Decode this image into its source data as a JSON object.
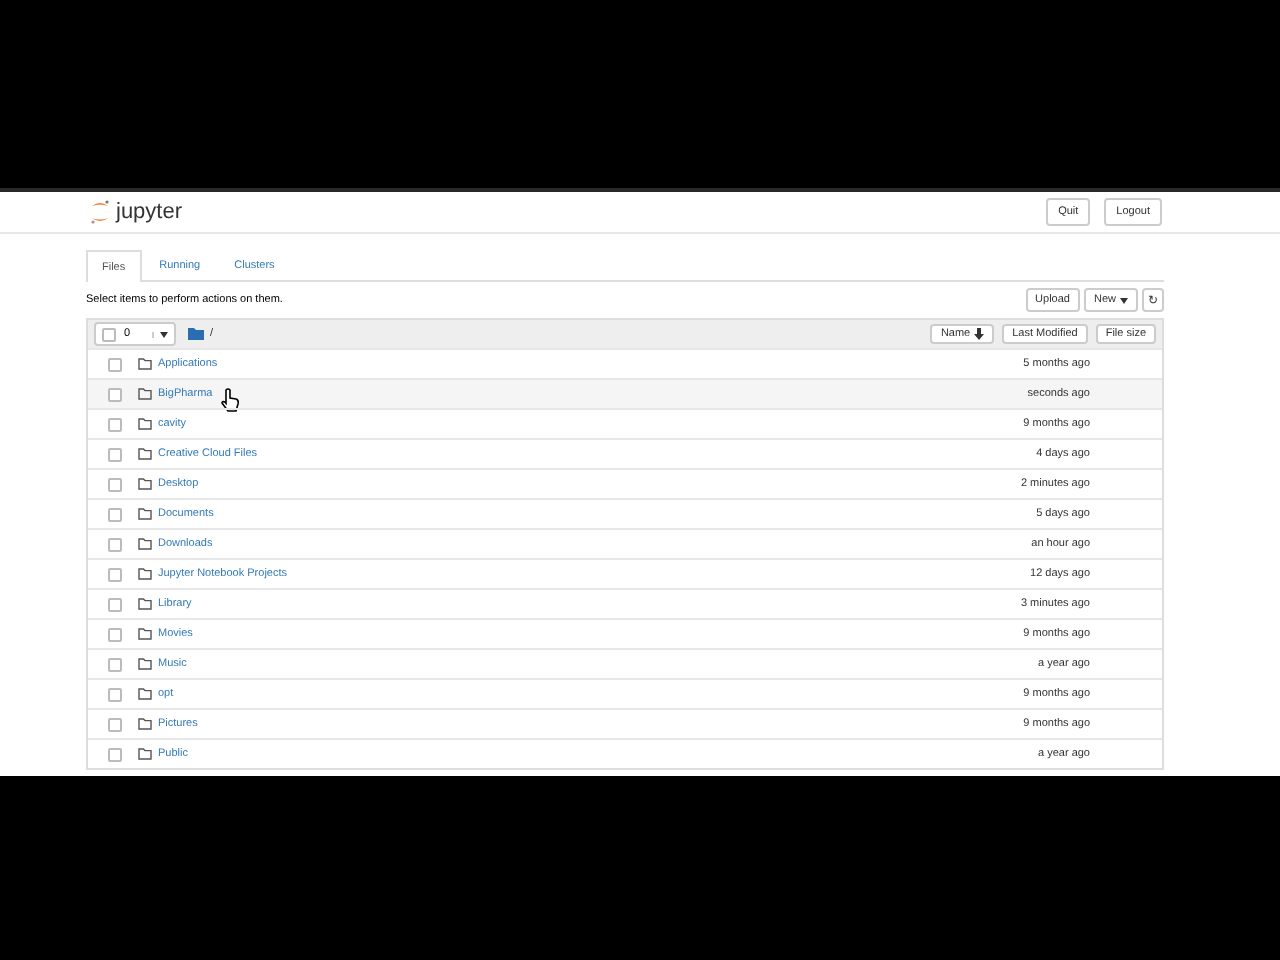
{
  "header": {
    "logo_text": "jupyter",
    "buttons": [
      "Quit",
      "Logout"
    ]
  },
  "tabs": [
    {
      "label": "Files",
      "selected": true
    },
    {
      "label": "Running",
      "selected": false
    },
    {
      "label": "Clusters",
      "selected": false
    }
  ],
  "hint": "Select items to perform actions on them.",
  "toolbar": {
    "upload": "Upload",
    "new": "New",
    "refresh_icon": "↻"
  },
  "list_header": {
    "selected_count": "0",
    "path": "/",
    "sort_buttons": [
      {
        "label": "Name",
        "sorted": true
      },
      {
        "label": "Last Modified",
        "sorted": false
      },
      {
        "label": "File size",
        "sorted": false
      }
    ]
  },
  "rows": [
    {
      "name": "Applications",
      "modified": "5 months ago",
      "hovered": false
    },
    {
      "name": "BigPharma",
      "modified": "seconds ago",
      "hovered": true
    },
    {
      "name": "cavity",
      "modified": "9 months ago",
      "hovered": false
    },
    {
      "name": "Creative Cloud Files",
      "modified": "4 days ago",
      "hovered": false
    },
    {
      "name": "Desktop",
      "modified": "2 minutes ago",
      "hovered": false
    },
    {
      "name": "Documents",
      "modified": "5 days ago",
      "hovered": false
    },
    {
      "name": "Downloads",
      "modified": "an hour ago",
      "hovered": false
    },
    {
      "name": "Jupyter Notebook Projects",
      "modified": "12 days ago",
      "hovered": false
    },
    {
      "name": "Library",
      "modified": "3 minutes ago",
      "hovered": false
    },
    {
      "name": "Movies",
      "modified": "9 months ago",
      "hovered": false
    },
    {
      "name": "Music",
      "modified": "a year ago",
      "hovered": false
    },
    {
      "name": "opt",
      "modified": "9 months ago",
      "hovered": false
    },
    {
      "name": "Pictures",
      "modified": "9 months ago",
      "hovered": false
    },
    {
      "name": "Public",
      "modified": "a year ago",
      "hovered": false
    }
  ]
}
